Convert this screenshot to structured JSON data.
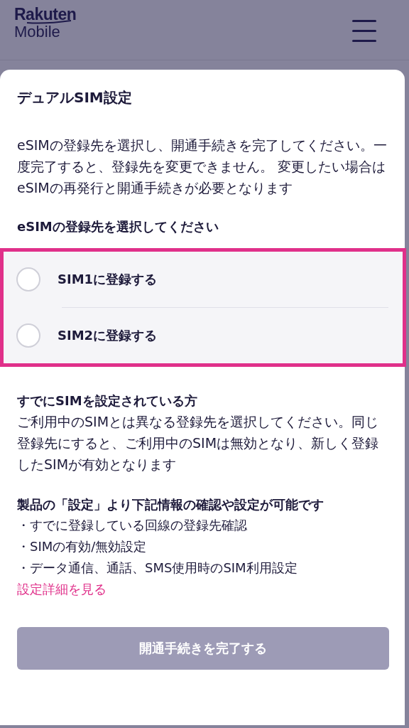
{
  "header": {
    "logo_top": "Rakuten",
    "logo_bottom": "Mobile"
  },
  "dialog": {
    "title": "デュアルSIM設定",
    "description": "eSIMの登録先を選択し、開通手続きを完了してください。一度完了すると、登録先を変更できません。 変更したい場合はeSIMの再発行と開通手続きが必要となります",
    "prompt": "eSIMの登録先を選択してください",
    "options": [
      {
        "label": "SIM1に登録する",
        "selected": false
      },
      {
        "label": "SIM2に登録する",
        "selected": false
      }
    ],
    "notice": {
      "heading": "すでにSIMを設定されている方",
      "body": "ご利用中のSIMとは異なる登録先を選択してください。同じ登録先にすると、ご利用中のSIMは無効となり、新しく登録したSIMが有効となります"
    },
    "settings": {
      "heading": "製品の「設定」より下記情報の確認や設定が可能です",
      "items": [
        "・すでに登録している回線の登録先確認",
        "・SIMの有効/無効設定",
        "・データ通信、通話、SMS使用時のSIM利用設定"
      ],
      "link": "設定詳細を見る"
    },
    "button": {
      "label": "開通手続きを完了する",
      "disabled": true
    }
  }
}
